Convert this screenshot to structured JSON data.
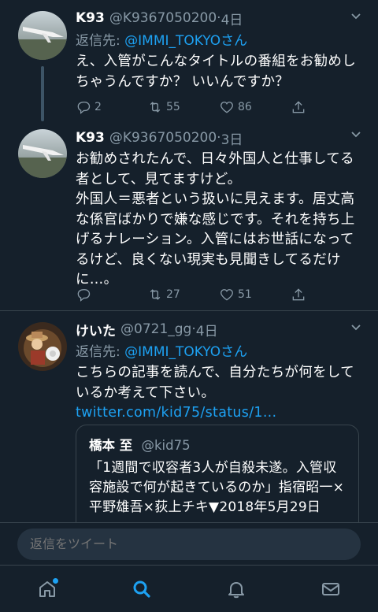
{
  "tweets": [
    {
      "name": "K93",
      "handle": "@K9367050200",
      "sep": "·",
      "time": "4日",
      "reply_prefix": "返信先: ",
      "reply_to": "@IMMI_TOKYOさん",
      "lines": [
        "え、入管がこんなタイトルの番組をお勧めし",
        "ちゃうんですか？ いいんですか？"
      ],
      "replies": "2",
      "retweets": "55",
      "likes": "86"
    },
    {
      "name": "K93",
      "handle": "@K9367050200",
      "sep": "·",
      "time": "3日",
      "lines": [
        "お勧めされたんで、日々外国人と仕事してる",
        "者として、見てますけど。",
        "外国人＝悪者という扱いに見えます。居丈高",
        "な係官ばかりで嫌な感じです。それを持ち上",
        "げるナレーション。入管にはお世話になって",
        "るけど、良くない現実も見聞きしてるだけ",
        "に…。"
      ],
      "replies": "",
      "retweets": "27",
      "likes": "51"
    },
    {
      "name": "けいた",
      "handle": "@0721_gg",
      "sep": "·",
      "time": "4日",
      "reply_prefix": "返信先: ",
      "reply_to": "@IMMI_TOKYOさん",
      "lines": [
        "こちらの記事を読んで、自分たちが何をして",
        "いるか考えて下さい。"
      ],
      "url": "twitter.com/kid75/status/1...",
      "quote": {
        "name": "橋本 至",
        "handle": "@kid75",
        "lines": [
          "「1週間で収容者3人が自殺未遂。入管収",
          "容施設で何が起きているのか」指宿昭一×",
          "平野雄吾×荻上チキ▼2018年5月29日"
        ]
      }
    }
  ],
  "compose": {
    "placeholder": "返信をツイート"
  },
  "tabs": [
    "home-icon",
    "search-icon",
    "bell-icon",
    "mail-icon"
  ],
  "colors": {
    "background": "#15202b",
    "accent": "#1da1f2",
    "muted": "#8899a6",
    "border": "#38444d"
  }
}
